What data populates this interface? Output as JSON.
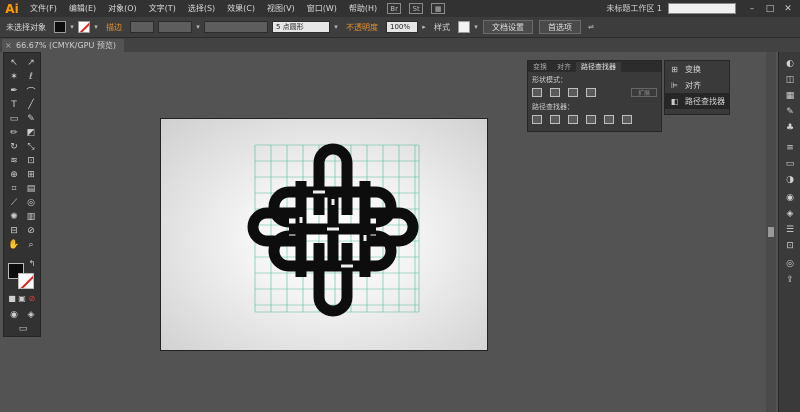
{
  "app": {
    "logo": "Ai",
    "menu": [
      "文件(F)",
      "编辑(E)",
      "对象(O)",
      "文字(T)",
      "选择(S)",
      "效果(C)",
      "视图(V)",
      "窗口(W)",
      "帮助(H)"
    ],
    "menu_icons": [
      "Br",
      "St"
    ],
    "workspace": "未标题工作区 1"
  },
  "control_bar": {
    "selection_label": "未选择对象",
    "stroke_label": "描边",
    "stroke_value": "",
    "brush_value": "5 点圆形",
    "opacity_label": "不透明度",
    "opacity_value": "100%",
    "style_label": "样式",
    "doc_setup_button": "文档设置",
    "preferences_button": "首选项"
  },
  "document": {
    "tab_label": "66.67% (CMYK/GPU 预览)"
  },
  "pathfinder_panel": {
    "tabs": [
      "变换",
      "对齐",
      "路径查找器"
    ],
    "shape_modes_label": "形状模式：",
    "expand_button": "扩展",
    "pathfinders_label": "路径查找器："
  },
  "dock_panel": {
    "items": [
      "变换",
      "对齐",
      "路径查找器"
    ]
  },
  "colors": {
    "fill": "#0d0d0d",
    "stroke": "#ffffff",
    "grid": "#38b38a",
    "accent": "#e8902a"
  }
}
